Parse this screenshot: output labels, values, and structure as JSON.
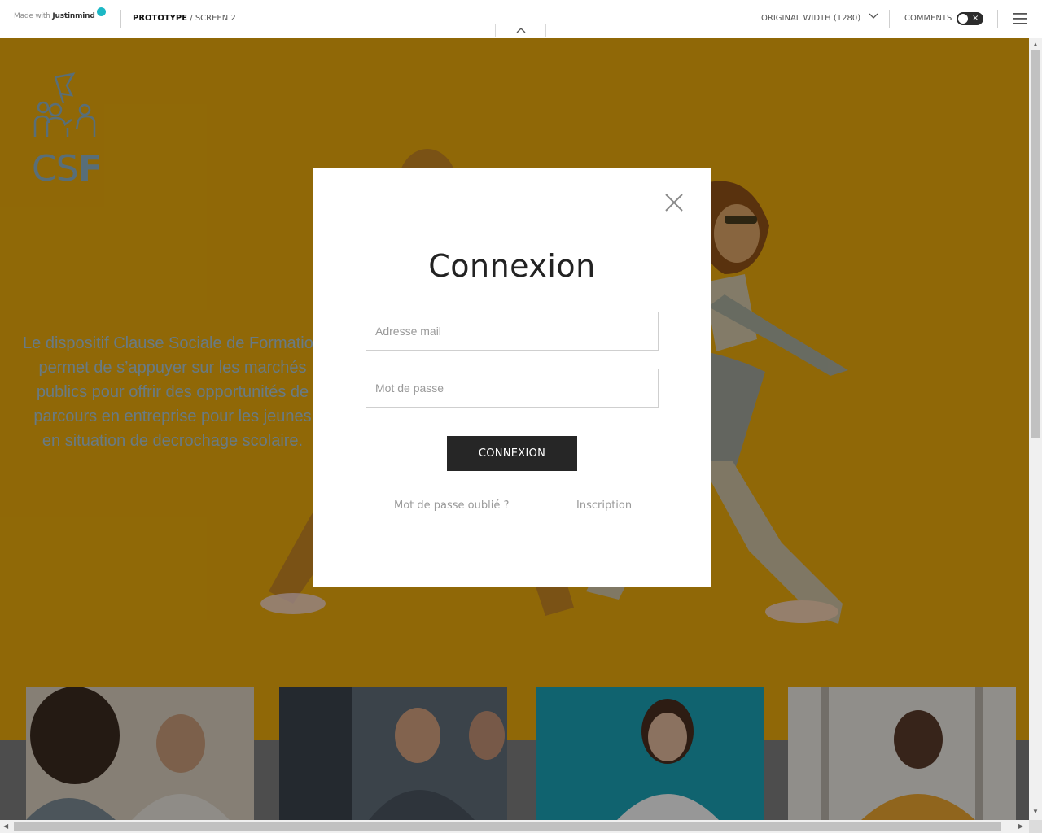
{
  "topbar": {
    "brand_prefix": "Made with",
    "brand_name": "Justinmind",
    "breadcrumb_root": "PROTOTYPE",
    "breadcrumb_sep": " / ",
    "breadcrumb_screen": "SCREEN 2",
    "width_label": "ORIGINAL WIDTH (1280)",
    "comments_label": "COMMENTS",
    "comments_toggle_symbol": "×",
    "icons": [
      "chevron-up-icon",
      "chevron-down-icon",
      "hamburger-menu-icon"
    ]
  },
  "hero": {
    "logo_text_light": "CS",
    "logo_text_bold": "F",
    "description": "Le dispositif Clause Sociale de Formation permet de s’appuyer sur les marchés publics pour offrir des opportunités de parcours en entreprise pour les jeunes en situation de decrochage scolaire."
  },
  "modal": {
    "title": "Connexion",
    "email_placeholder": "Adresse mail",
    "email_value": "",
    "password_placeholder": "Mot de passe",
    "password_value": "",
    "submit_label": "CONNEXION",
    "forgot_link": "Mot de passe oublié ?",
    "register_link": "Inscription"
  },
  "colors": {
    "hero_yellow": "#e9a90c",
    "logo_blue": "#8fb2c4",
    "button_dark": "#262626",
    "brand_teal": "#1cb8c5"
  },
  "scroll": {
    "up_arrow": "▲",
    "down_arrow": "▼",
    "left_arrow": "◀",
    "right_arrow": "▶"
  }
}
